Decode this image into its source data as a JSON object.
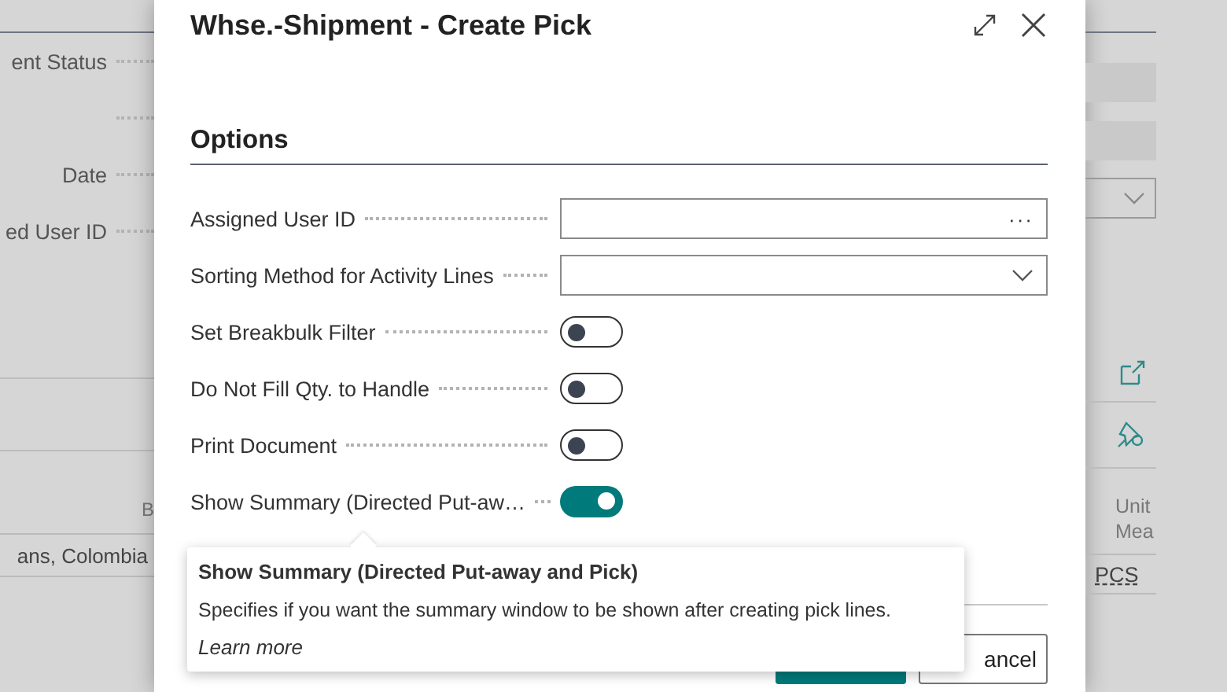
{
  "background_page": {
    "left_labels": [
      {
        "kind": "label",
        "label": "ent Status"
      },
      {
        "kind": "leader_only"
      },
      {
        "kind": "label",
        "label": "Date"
      },
      {
        "kind": "label",
        "label": "ed User ID"
      }
    ],
    "left_table": {
      "column_header": "B",
      "cell": "ans, Colombia"
    },
    "right_table": {
      "column_header": [
        "Unit",
        "Mea"
      ],
      "cell": "PCS"
    }
  },
  "dialog": {
    "title": "Whse.-Shipment - Create Pick",
    "section": "Options",
    "fields": [
      {
        "kind": "lookup",
        "label": "Assigned User ID",
        "button": "···"
      },
      {
        "kind": "dropdown",
        "label": "Sorting Method for Activity Lines"
      },
      {
        "kind": "toggle",
        "label": "Set Breakbulk Filter",
        "on": false
      },
      {
        "kind": "toggle",
        "label": "Do Not Fill Qty. to Handle",
        "on": false
      },
      {
        "kind": "toggle",
        "label": "Print Document",
        "on": false
      },
      {
        "kind": "toggle",
        "label": "Show Summary (Directed Put-aw…",
        "on": true
      }
    ],
    "tooltip": {
      "title": "Show Summary (Directed Put-away and Pick)",
      "text": "Specifies if you want the summary window to be shown after creating pick lines.",
      "link": "Learn more"
    },
    "buttons": [
      {
        "kind": "primary"
      },
      {
        "kind": "secondary",
        "label": "ancel"
      }
    ]
  }
}
